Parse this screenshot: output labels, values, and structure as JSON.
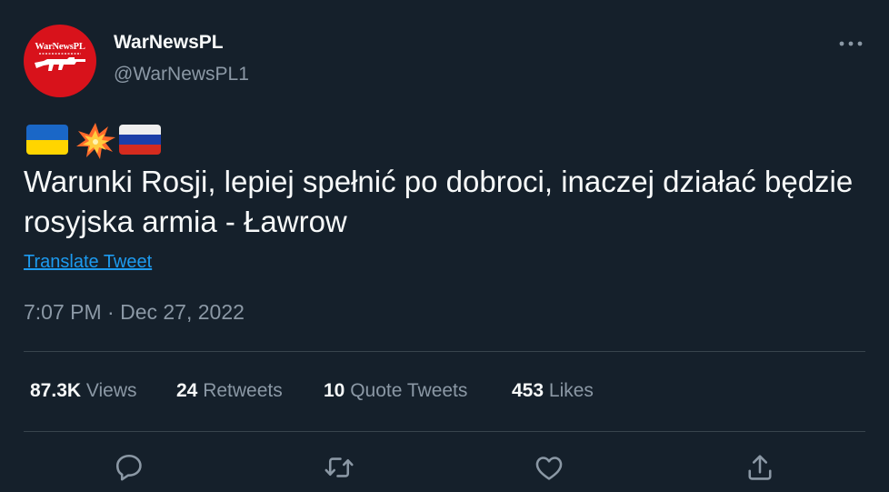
{
  "author": {
    "display_name": "WarNewsPL",
    "handle": "@WarNewsPL1",
    "avatar_logo_text": "WarNewsPL",
    "avatar_color": "#d8121b"
  },
  "tweet": {
    "emojis": [
      "flag-ukraine",
      "collision",
      "flag-russia"
    ],
    "text": "Warunki Rosji, lepiej spełnić po dobroci, inaczej działać będzie rosyjska armia - Ławrow",
    "translate_label": "Translate Tweet",
    "timestamp": "7:07 PM · Dec 27, 2022"
  },
  "stats": {
    "views_count": "87.3K",
    "views_label": "Views",
    "retweets_count": "24",
    "retweets_label": "Retweets",
    "quotes_count": "10",
    "quotes_label": "Quote Tweets",
    "likes_count": "453",
    "likes_label": "Likes"
  },
  "actions": [
    "reply-icon",
    "retweet-icon",
    "like-icon",
    "share-icon"
  ],
  "colors": {
    "background": "#15202b",
    "text": "#f7f9f9",
    "secondary_text": "#8b98a5",
    "link": "#1d9bf0",
    "divider": "#38444d"
  }
}
